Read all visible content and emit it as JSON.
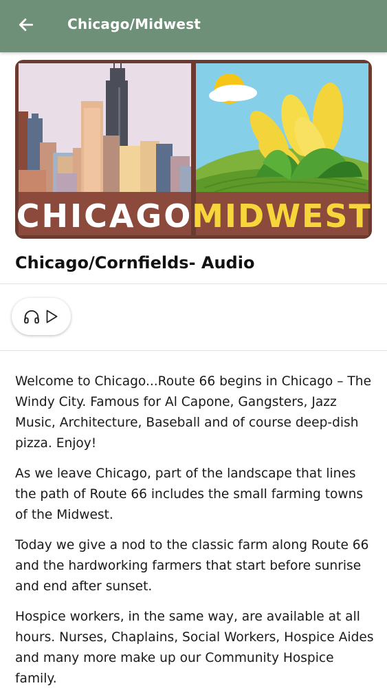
{
  "header": {
    "title": "Chicago/Midwest",
    "background_color": "#6e8f78",
    "back_icon": "arrow-left-icon"
  },
  "banner": {
    "left_text": "CHICAGO",
    "right_text": "MIDWEST",
    "colors": {
      "frame": "#6b3b2f",
      "left_sky": "#e9dde8",
      "right_sky": "#86cfe8",
      "text_left": "#ffffff",
      "text_right": "#f6d63a"
    }
  },
  "audio": {
    "title": "Chicago/Cornfields- Audio",
    "headphones_icon": "headphones-icon",
    "play_icon": "play-icon"
  },
  "content": {
    "paragraphs": [
      "Welcome to Chicago...Route 66 begins in Chicago – The Windy City. Famous for Al Capone, Gangsters, Jazz Music, Architecture, Baseball and of course deep-dish pizza. Enjoy!",
      "As we leave Chicago, part of the landscape that lines the path of Route 66 includes the small farming towns of the Midwest.",
      "Today we give a nod to the classic farm along Route 66 and the hardworking farmers that start before sunrise and end after sunset.",
      "Hospice workers, in the same way, are available at all hours. Nurses, Chaplains, Social Workers, Hospice Aides and many more make up our Community Hospice family."
    ]
  }
}
